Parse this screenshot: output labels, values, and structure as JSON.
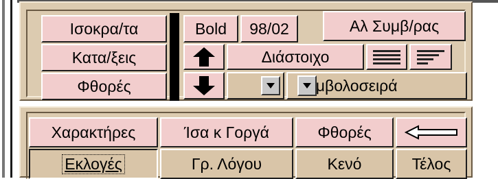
{
  "top_panel": {
    "isokrata_label": "Ισοκρα/τα",
    "bold_label": "Bold",
    "version_label": "98/02",
    "al_symv_label": "Αλ Συμβ/ρας",
    "kataxeis_label": "Κατα/ξεις",
    "diastoixo_label": "Διάστοιχο",
    "fthores_label": "Φθορές",
    "symvoloseira_label": "Συμβολοσειρά",
    "up_icon": "arrow-up-icon",
    "down_icon": "arrow-down-icon",
    "dropdown_icon": "chevron-down-icon",
    "align_full_icon": "align-justify-icon",
    "align_left_icon": "align-left-icon"
  },
  "bottom_panel": {
    "xaraktires_label": "Χαρακτήρες",
    "isa_gorga_label": "Ίσα κ Γοργά",
    "fthores_label": "Φθορές",
    "back_icon": "arrow-left-icon",
    "ekloges_label": "Εκλογές",
    "gr_logou_label": "Γρ. Λόγου",
    "keno_label": "Κενό",
    "telos_label": "Τέλος"
  },
  "colors": {
    "panel": "#dccbb0",
    "pink_button": "#f2cdcd",
    "tan_button": "#d9c5a8"
  }
}
